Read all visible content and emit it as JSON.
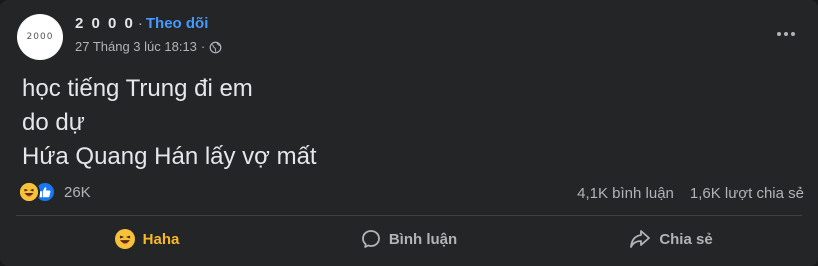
{
  "post": {
    "author": {
      "name": "2 0 0 0",
      "avatar_text": "2000",
      "separator": "·",
      "follow_label": "Theo dõi"
    },
    "timestamp": "27 Tháng 3 lúc 18:13",
    "meta_separator": "·",
    "privacy_icon": "globe-icon",
    "content_lines": [
      "học tiếng Trung đi em",
      "do dự",
      "Hứa Quang Hán lấy vợ mất"
    ],
    "reactions": {
      "icons": [
        "haha-icon",
        "like-icon"
      ],
      "count": "26K"
    },
    "stats": {
      "comments": "4,1K bình luận",
      "shares": "1,6K lượt chia sẻ"
    },
    "actions": [
      {
        "label": "Haha",
        "icon": "haha-icon",
        "active": true
      },
      {
        "label": "Bình luận",
        "icon": "comment-icon",
        "active": false
      },
      {
        "label": "Chia sẻ",
        "icon": "share-icon",
        "active": false
      }
    ]
  },
  "colors": {
    "background": "#242526",
    "text_primary": "#e4e6eb",
    "text_secondary": "#b0b3b8",
    "link": "#4599ff",
    "haha_active": "#f7b928",
    "like_blue": "#1877f2"
  }
}
